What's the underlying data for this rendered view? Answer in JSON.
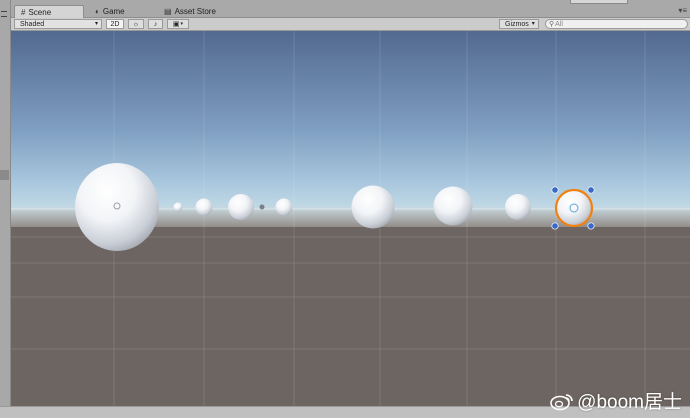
{
  "tabs": [
    {
      "label": "Scene",
      "icon": "scene-icon"
    },
    {
      "label": "Game",
      "icon": "game-icon"
    },
    {
      "label": "Asset Store",
      "icon": "store-icon"
    }
  ],
  "toolbar": {
    "shading_mode": "Shaded",
    "mode_2d": "2D",
    "gizmos": "Gizmos",
    "search_placeholder": "All"
  },
  "viewport": {
    "sky_top": "#53698f",
    "horizon": "#b6d2e2",
    "ground": "#6d6561",
    "selection_color": "#f08010",
    "handle_color": "#3a6ac8"
  },
  "watermark": "@boom居士"
}
